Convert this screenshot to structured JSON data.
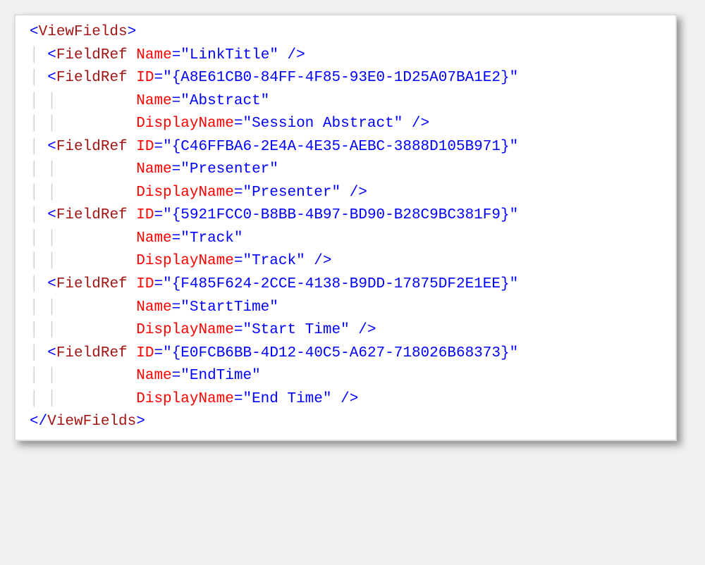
{
  "root": {
    "open_bracket": "<",
    "name": "ViewFields",
    "close_bracket": ">",
    "close_open": "</",
    "close_close": ">"
  },
  "f1": {
    "tag": "FieldRef",
    "name_attr": "Name",
    "name_val": "\"LinkTitle\""
  },
  "f2": {
    "tag": "FieldRef",
    "id_attr": "ID",
    "id_val": "\"{A8E61CB0-84FF-4F85-93E0-1D25A07BA1E2}\"",
    "name_attr": "Name",
    "name_val": "\"Abstract\"",
    "disp_attr": "DisplayName",
    "disp_val": "\"Session Abstract\""
  },
  "f3": {
    "tag": "FieldRef",
    "id_attr": "ID",
    "id_val": "\"{C46FFBA6-2E4A-4E35-AEBC-3888D105B971}\"",
    "name_attr": "Name",
    "name_val": "\"Presenter\"",
    "disp_attr": "DisplayName",
    "disp_val": "\"Presenter\""
  },
  "f4": {
    "tag": "FieldRef",
    "id_attr": "ID",
    "id_val": "\"{5921FCC0-B8BB-4B97-BD90-B28C9BC381F9}\"",
    "name_attr": "Name",
    "name_val": "\"Track\"",
    "disp_attr": "DisplayName",
    "disp_val": "\"Track\""
  },
  "f5": {
    "tag": "FieldRef",
    "id_attr": "ID",
    "id_val": "\"{F485F624-2CCE-4138-B9DD-17875DF2E1EE}\"",
    "name_attr": "Name",
    "name_val": "\"StartTime\"",
    "disp_attr": "DisplayName",
    "disp_val": "\"Start Time\""
  },
  "f6": {
    "tag": "FieldRef",
    "id_attr": "ID",
    "id_val": "\"{E0FCB6BB-4D12-40C5-A627-718026B68373}\"",
    "name_attr": "Name",
    "name_val": "\"EndTime\"",
    "disp_attr": "DisplayName",
    "disp_val": "\"End Time\""
  },
  "eq": "=",
  "selfclose": " />",
  "gt": ">",
  "lt": "<",
  "guide1": "│ ",
  "guide_cont": "│         "
}
